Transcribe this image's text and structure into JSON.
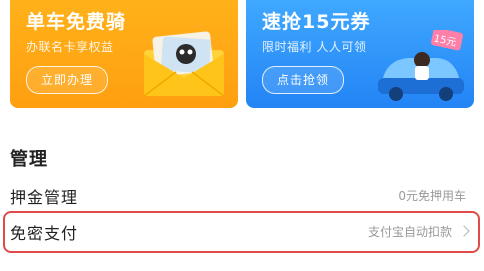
{
  "promos": [
    {
      "title": "单车免费骑",
      "subtitle": "办联名卡享权益",
      "button": "立即办理",
      "icon": "card-envelope-illustration"
    },
    {
      "title": "速抢15元券",
      "subtitle": "限时福利 人人可领",
      "button": "点击抢领",
      "badge": "15元",
      "icon": "car-coupon-illustration"
    }
  ],
  "manage": {
    "title": "管理",
    "items": [
      {
        "label": "押金管理",
        "value": "0元免押用车"
      },
      {
        "label": "免密支付",
        "value": "支付宝自动扣款"
      }
    ]
  },
  "colors": {
    "promo_left": "#ffa514",
    "promo_right": "#2f95fa",
    "highlight": "#e04a4a"
  }
}
